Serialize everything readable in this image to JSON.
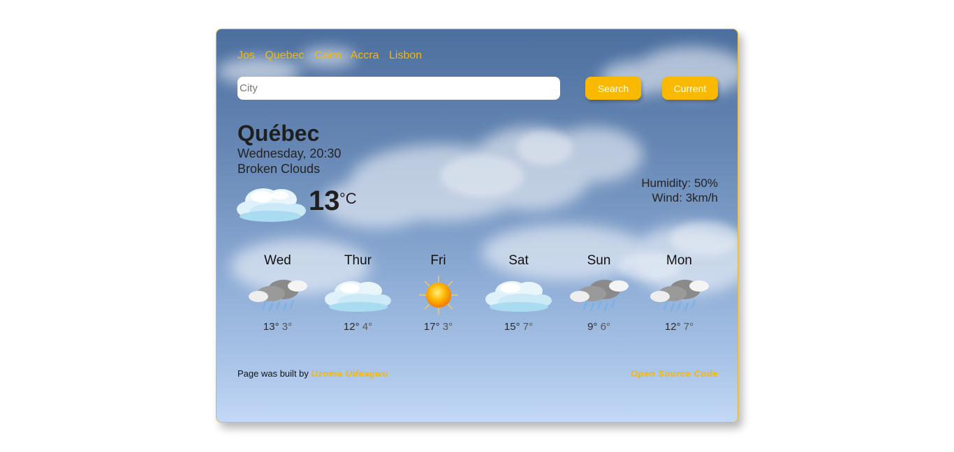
{
  "cities": [
    "Jos",
    "Quebec",
    "Cairo",
    "Accra",
    "Lisbon"
  ],
  "search": {
    "placeholder": "City",
    "search_label": "Search",
    "current_label": "Current"
  },
  "current": {
    "city": "Québec",
    "date": "Wednesday, 20:30",
    "description": "Broken Clouds",
    "temperature": "13",
    "unit": "°C",
    "icon": "broken-clouds-icon",
    "humidity": "Humidity: 50%",
    "wind": "Wind: 3km/h"
  },
  "forecast": [
    {
      "day": "Wed",
      "high": "13°",
      "low": "3°",
      "icon": "rain-cloud-icon"
    },
    {
      "day": "Thur",
      "high": "12°",
      "low": "4°",
      "icon": "cloud-icon"
    },
    {
      "day": "Fri",
      "high": "17°",
      "low": "3°",
      "icon": "sun-icon"
    },
    {
      "day": "Sat",
      "high": "15°",
      "low": "7°",
      "icon": "cloud-icon"
    },
    {
      "day": "Sun",
      "high": "9°",
      "low": "6°",
      "icon": "rain-cloud-icon"
    },
    {
      "day": "Mon",
      "high": "12°",
      "low": "7°",
      "icon": "rain-cloud-icon"
    }
  ],
  "footer": {
    "prefix": "Page was built by",
    "author": "Uzoma Udeagwu",
    "source_link": "Open Source Code"
  },
  "colors": {
    "accent": "#f8b900",
    "border": "#e9b63a",
    "sky_top": "#4c6f9f",
    "sky_bottom": "#c3d8f6"
  }
}
